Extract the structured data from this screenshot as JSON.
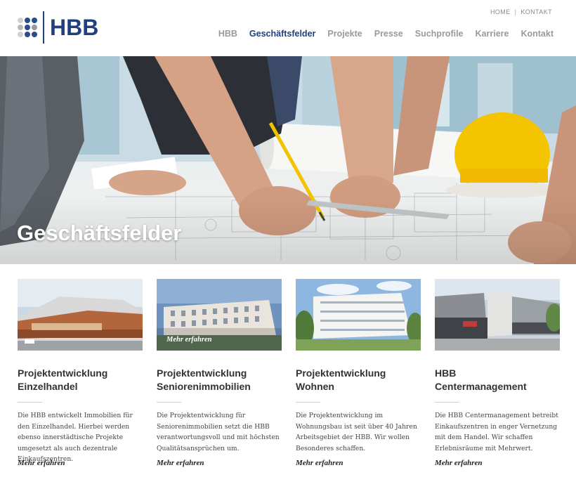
{
  "colors": {
    "brand": "#1f3f7f",
    "nav_inactive": "#9a9a9a",
    "helmet": "#f2c300"
  },
  "logo": {
    "text": "HBB"
  },
  "util_nav": {
    "home": "HOME",
    "separator": "|",
    "contact": "KONTAKT"
  },
  "main_nav": {
    "items": [
      {
        "label": "HBB",
        "active": false
      },
      {
        "label": "Geschäftsfelder",
        "active": true
      },
      {
        "label": "Projekte",
        "active": false
      },
      {
        "label": "Presse",
        "active": false
      },
      {
        "label": "Suchprofile",
        "active": false
      },
      {
        "label": "Karriere",
        "active": false
      },
      {
        "label": "Kontakt",
        "active": false
      }
    ]
  },
  "hero": {
    "title": "Geschäftsfelder"
  },
  "cards": [
    {
      "title_line1": "Projektentwicklung",
      "title_line2": "Einzelhandel",
      "text": "Die HBB entwickelt Immobilien für den Einzelhandel. Hierbei werden ebenso innerstädtische Projekte umgesetzt als auch dezentrale Einkaufszentren.",
      "link": "Mehr erfahren",
      "image_overlay": ""
    },
    {
      "title_line1": "Projektentwicklung",
      "title_line2": "Seniorenimmobilien",
      "text": "Die Projektentwicklung für Seniorenimmobilien setzt die HBB verantwortungsvoll und mit höchsten Qualitätsansprüchen um.",
      "link": "Mehr erfahren",
      "image_overlay": "Mehr erfahren"
    },
    {
      "title_line1": "Projektentwicklung",
      "title_line2": "Wohnen",
      "text": "Die Projektentwicklung im Wohnungsbau ist seit über 40 Jahren Arbeitsgebiet der HBB. Wir wollen Besonderes schaffen.",
      "link": "Mehr erfahren",
      "image_overlay": ""
    },
    {
      "title_line1": "HBB",
      "title_line2": "Centermanagement",
      "text": "Die HBB Centermanagement betreibt Einkaufszentren in enger Vernetzung mit dem Handel. Wir schaffen Erlebnisräume mit Mehrwert.",
      "link": "Mehr erfahren",
      "image_overlay": ""
    }
  ]
}
